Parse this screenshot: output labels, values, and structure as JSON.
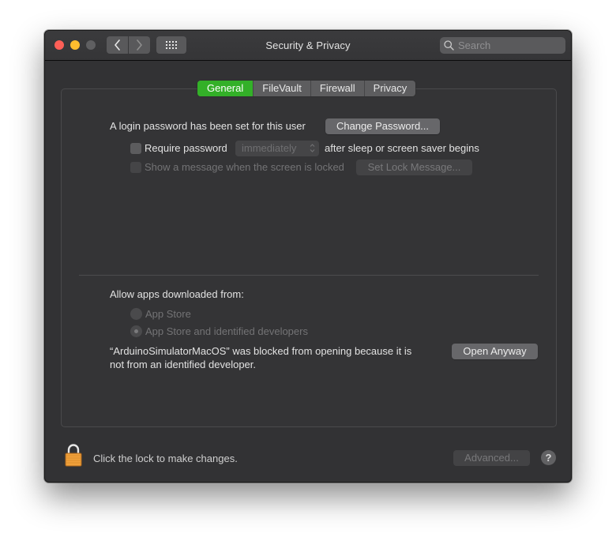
{
  "window": {
    "title": "Security & Privacy",
    "search_placeholder": "Search",
    "traffic_lights": {
      "close": "#fe5f57",
      "minimize": "#febc2e",
      "maximize": "#5f5f61"
    }
  },
  "tabs": [
    {
      "label": "General",
      "active": true
    },
    {
      "label": "FileVault",
      "active": false
    },
    {
      "label": "Firewall",
      "active": false
    },
    {
      "label": "Privacy",
      "active": false
    }
  ],
  "accent_color": "#33b028",
  "general": {
    "login_password_text": "A login password has been set for this user",
    "change_password_button": "Change Password...",
    "require_password": {
      "label": "Require password",
      "checked": false,
      "select_value": "immediately",
      "suffix": "after sleep or screen saver begins"
    },
    "show_message": {
      "label": "Show a message when the screen is locked",
      "checked": false,
      "enabled": false,
      "button": "Set Lock Message..."
    },
    "allow_apps": {
      "label": "Allow apps downloaded from:",
      "options": [
        {
          "label": "App Store",
          "selected": false
        },
        {
          "label": "App Store and identified developers",
          "selected": true
        }
      ]
    },
    "blocked": {
      "line1": "“ArduinoSimulatorMacOS” was blocked from opening because it is",
      "line2": "not from an identified developer.",
      "button": "Open Anyway"
    }
  },
  "footer": {
    "lock_text": "Click the lock to make changes.",
    "advanced_button": "Advanced...",
    "help_label": "?"
  }
}
